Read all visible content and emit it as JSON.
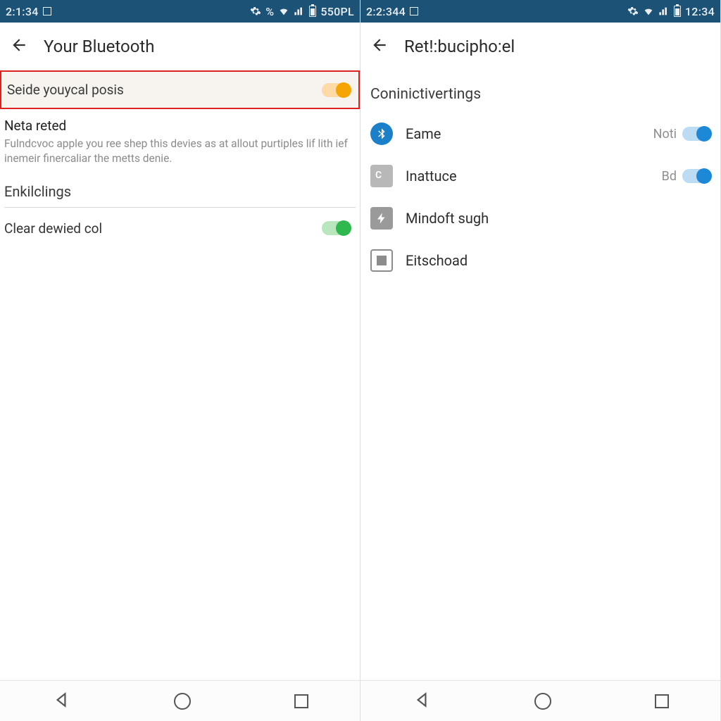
{
  "left": {
    "status": {
      "time": "2:1:34",
      "right_text": "550PL"
    },
    "appbar": {
      "title": "Your Bluetooth"
    },
    "main_toggle": {
      "label": "Seide youycal posis"
    },
    "info": {
      "heading": "Neta reted",
      "body": "Fulndcvoc apple you ree shep this devies as at allout purtiples lif lith ief inemeir finercaliar the metts denie."
    },
    "section1": {
      "header": "Enkilclings"
    },
    "clear": {
      "label": "Clear dewied col"
    }
  },
  "right": {
    "status": {
      "time": "2:2:344",
      "right_text": "12:34"
    },
    "appbar": {
      "title": "Ret!:bucipho:el"
    },
    "section": {
      "header": "Coninictivertings"
    },
    "items": [
      {
        "label": "Eame",
        "trailing": "Noti"
      },
      {
        "label": "Inattuce",
        "trailing": "Bd"
      },
      {
        "label": "Mindoft sugh",
        "trailing": ""
      },
      {
        "label": "Eitschoad",
        "trailing": ""
      }
    ]
  }
}
